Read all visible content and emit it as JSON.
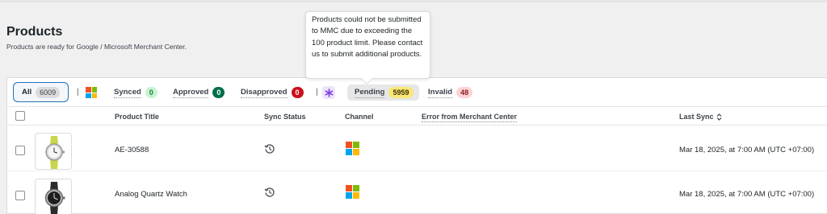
{
  "page": {
    "title": "Products",
    "subtitle": "Products are ready for Google / Microsoft Merchant Center."
  },
  "tooltip": {
    "text": "Products could not be submitted to MMC due to exceeding the 100 product limit. Please contact us to submit additional products."
  },
  "filters": {
    "all": {
      "label": "All",
      "count": "6009"
    },
    "microsoft_icon": "microsoft-logo",
    "synced": {
      "label": "Synced",
      "count": "0"
    },
    "approved": {
      "label": "Approved",
      "count": "0"
    },
    "disapproved": {
      "label": "Disapproved",
      "count": "0"
    },
    "google_icon": "asterisk-icon",
    "pending": {
      "label": "Pending",
      "count": "5959"
    },
    "invalid": {
      "label": "Invalid",
      "count": "48"
    },
    "separator": "|"
  },
  "table": {
    "columns": {
      "title": "Product Title",
      "sync_status": "Sync Status",
      "channel": "Channel",
      "error": "Error from Merchant Center",
      "last_sync": "Last Sync"
    },
    "rows": [
      {
        "title": "AE-30588",
        "sync_icon": "history-icon",
        "channel": "microsoft-logo",
        "error": "",
        "last_sync": "Mar 18, 2025, at 7:00 AM (UTC +07:00)"
      },
      {
        "title": "Analog Quartz Watch",
        "sync_icon": "history-icon",
        "channel": "microsoft-logo",
        "error": "",
        "last_sync": "Mar 18, 2025, at 7:00 AM (UTC +07:00)"
      }
    ]
  },
  "colors": {
    "accent": "#2271b1",
    "synced_badge": "#c7f3d2",
    "approved_badge": "#00704a",
    "disapproved_badge": "#c9111c",
    "pending_badge": "#f9e777",
    "invalid_badge": "#fbd4d6"
  }
}
